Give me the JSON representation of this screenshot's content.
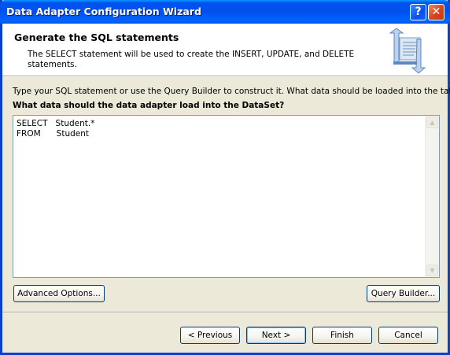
{
  "window": {
    "title": "Data Adapter Configuration Wizard",
    "help_label": "?",
    "close_label": "✕"
  },
  "header": {
    "title": "Generate the SQL statements",
    "description": "The SELECT statement will be used to create the INSERT, UPDATE, and DELETE statements."
  },
  "body": {
    "instruction": "Type your SQL statement or use the Query Builder to construct it. What data should be loaded into the table?",
    "question": "What data should the data adapter load into the DataSet?",
    "sql_text": "SELECT   Student.*\nFROM      Student"
  },
  "buttons": {
    "advanced_options": "Advanced Options...",
    "query_builder": "Query Builder...",
    "previous": "< Previous",
    "next": "Next >",
    "finish": "Finish",
    "cancel": "Cancel"
  },
  "icons": {
    "help": "help-icon",
    "close": "close-icon",
    "wizard_header": "data-adapter-wizard-icon",
    "scroll_up": "scroll-up-arrow-icon",
    "scroll_down": "scroll-down-arrow-icon"
  },
  "colors": {
    "titlebar": "#0053ee",
    "window_bg": "#ece9d8",
    "header_bg": "#ffffff",
    "button_border": "#003c74"
  }
}
